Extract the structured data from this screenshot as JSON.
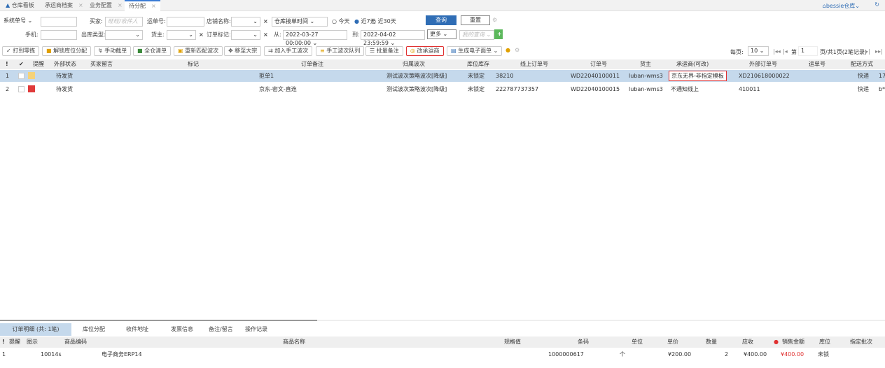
{
  "tabs": [
    {
      "label": "仓库看板"
    },
    {
      "label": "承运商档案"
    },
    {
      "label": "业务配置"
    },
    {
      "label": "待分配"
    }
  ],
  "user": {
    "warehouse": "bessie仓库"
  },
  "filters": {
    "sys_no": "系统单号",
    "buyer_label": "买家:",
    "buyer_placeholder": "旺旺/收件人",
    "waybill_label": "运单号:",
    "shop_label": "店铺名称:",
    "time_type": "仓库接单时间",
    "today": "今天",
    "last7": "近7天",
    "last30": "近30天",
    "search": "查询",
    "reset": "重置",
    "phone_label": "手机:",
    "outtype_label": "出库类型:",
    "owner_label": "货主:",
    "mark_label": "订单标记:",
    "from_label": "从:",
    "from_value": "2022-03-27 00:00:00",
    "to_label": "到:",
    "to_value": "2022-04-02 23:59:59",
    "more": "更多",
    "my_query": "我的查询"
  },
  "toolbar": [
    "打到零拣",
    "解锁库位分配",
    "手动截单",
    "全仓清单",
    "重新匹配波次",
    "移至大宗",
    "加入手工波次",
    "手工波次队列",
    "批量备注",
    "改承运商",
    "生成电子面单"
  ],
  "pager": {
    "per_page_label": "每页:",
    "per_page": "10",
    "page_label": "第",
    "page": "1",
    "total": "页/共1页(2笔记录)"
  },
  "columns": [
    "!",
    "✔",
    "提醒",
    "外部状态",
    "买家留言",
    "标记",
    "订单备注",
    "归属波次",
    "库位库存",
    "线上订单号",
    "订单号",
    "货主",
    "承运商(可改)",
    "外部订单号",
    "运单号",
    "配送方式"
  ],
  "rows": [
    {
      "no": "1",
      "status": "待发货",
      "remark": "拒单1",
      "wave": "测试波次策略波次[降级]",
      "stock": "未锁定",
      "online_no": "38210",
      "order_no": "WD22040100011",
      "owner": "luban-wms3",
      "carrier": "京东无界-非指定模板",
      "ext_no": "XD210618000022",
      "ship": "快递",
      "extra": "17"
    },
    {
      "no": "2",
      "status": "待发货",
      "remark": "京东-密文-直连",
      "wave": "测试波次策略波次[降级]",
      "stock": "未锁定",
      "online_no": "222787737357",
      "order_no": "WD22040100015",
      "owner": "luban-wms3",
      "carrier": "不通知线上",
      "ext_no": "410011",
      "ship": "快递",
      "extra": "b*"
    }
  ],
  "bottom_tabs": [
    "订单明细 (共: 1笔)",
    "库位分配",
    "收件地址",
    "发票信息",
    "备注/留言",
    "操作记录"
  ],
  "detail_columns": [
    "!",
    "提醒",
    "图示",
    "商品编码",
    "商品名称",
    "规格值",
    "条码",
    "单位",
    "单价",
    "数量",
    "应收",
    "销售金额",
    "库位",
    "指定批次"
  ],
  "detail_rows": [
    {
      "no": "1",
      "code": "10014s",
      "name": "电子商务ERP14",
      "barcode": "1000000617",
      "unit": "个",
      "price": "¥200.00",
      "qty": "2",
      "receivable": "¥400.00",
      "amount": "¥400.00",
      "location": "未锁"
    }
  ],
  "colors": {
    "accent": "#2f6db5",
    "selected_row": "#c5d9ec",
    "highlight": "#e03030",
    "add": "#5cb85c"
  }
}
